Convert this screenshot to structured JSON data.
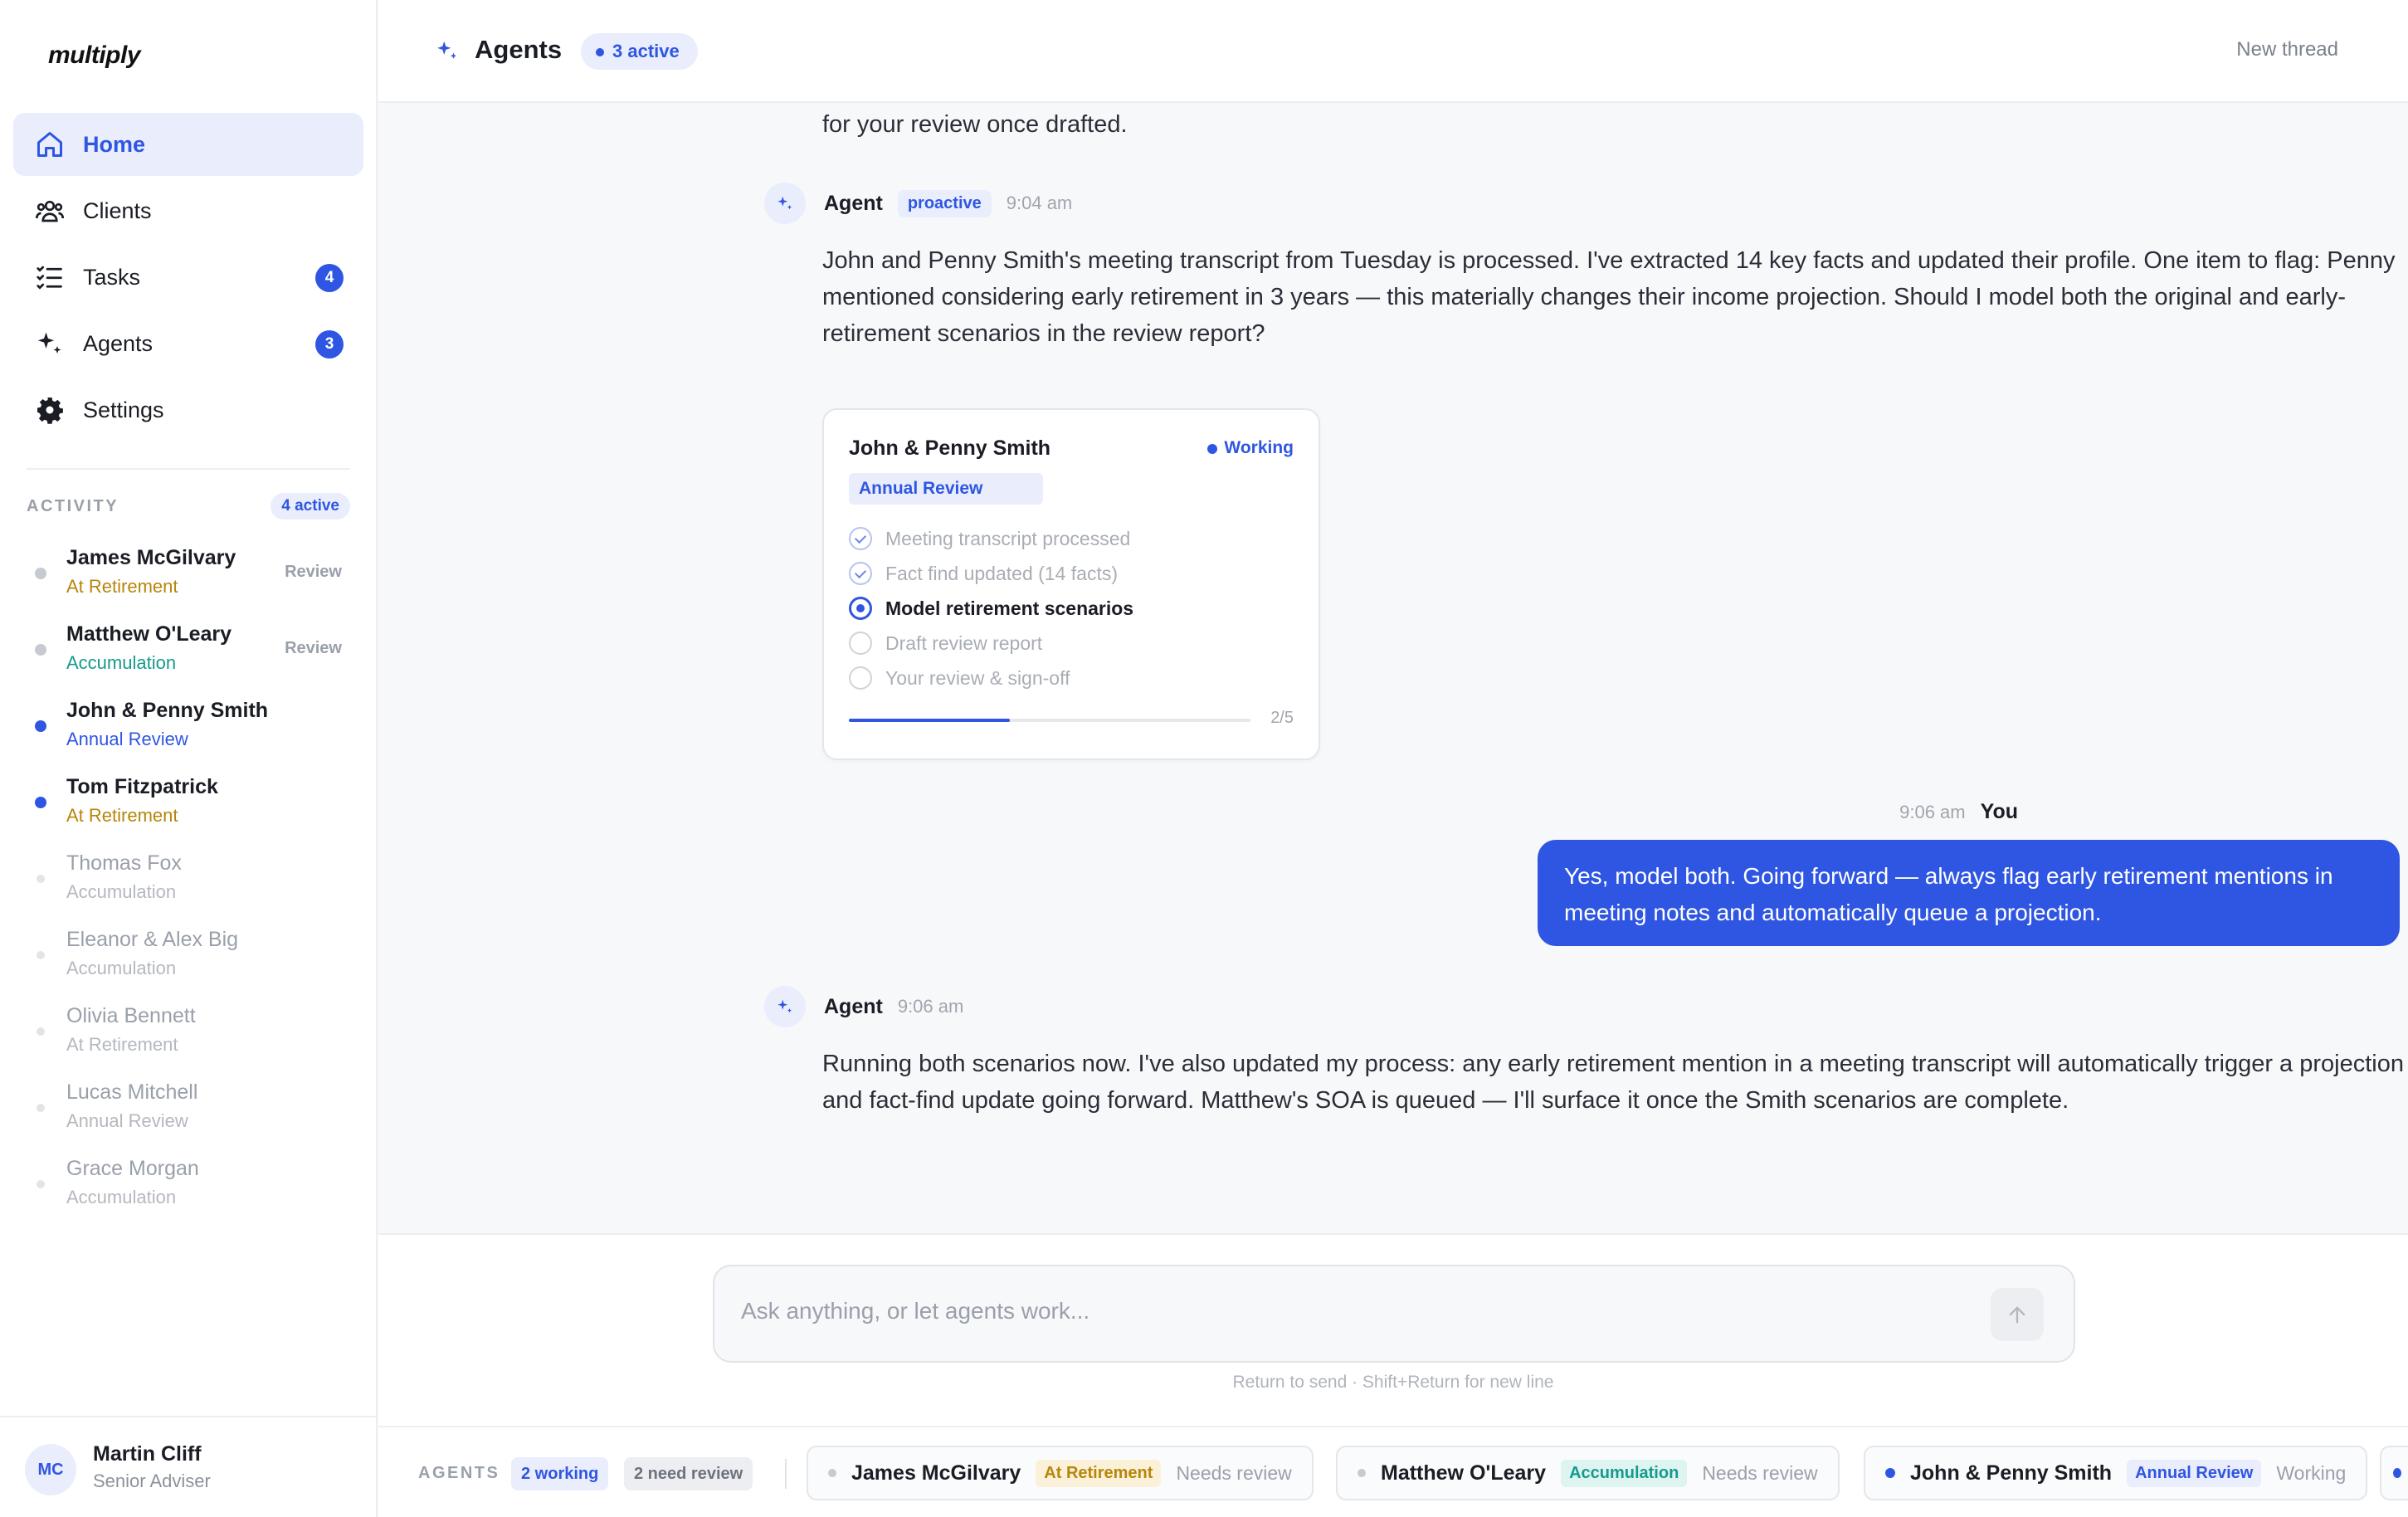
{
  "app": {
    "logo": "multiply"
  },
  "nav": [
    {
      "label": "Home",
      "icon": "home-icon",
      "active": true,
      "badge": ""
    },
    {
      "label": "Clients",
      "icon": "users-icon",
      "active": false,
      "badge": ""
    },
    {
      "label": "Tasks",
      "icon": "list-icon",
      "active": false,
      "badge": "4"
    },
    {
      "label": "Agents",
      "icon": "sparkle-icon",
      "active": false,
      "badge": "3"
    },
    {
      "label": "Settings",
      "icon": "gear-icon",
      "active": false,
      "badge": ""
    }
  ],
  "activity": {
    "label": "ACTIVITY",
    "count": "4 active",
    "items": [
      {
        "name": "James McGilvary",
        "stage": "At Retirement",
        "status": "Review"
      },
      {
        "name": "Matthew O'Leary",
        "stage": "Accumulation",
        "status": "Review"
      },
      {
        "name": "John & Penny Smith",
        "stage": "Annual Review",
        "status": ""
      },
      {
        "name": "Tom Fitzpatrick",
        "stage": "At Retirement",
        "status": ""
      },
      {
        "name": "Thomas Fox",
        "stage": "Accumulation",
        "status": ""
      },
      {
        "name": "Eleanor & Alex Big",
        "stage": "Accumulation",
        "status": ""
      },
      {
        "name": "Olivia Bennett",
        "stage": "At Retirement",
        "status": ""
      },
      {
        "name": "Lucas Mitchell",
        "stage": "Annual Review",
        "status": ""
      },
      {
        "name": "Grace Morgan",
        "stage": "Accumulation",
        "status": ""
      }
    ]
  },
  "user": {
    "initials": "MC",
    "name": "Martin Cliff",
    "role": "Senior Adviser"
  },
  "header": {
    "title": "Agents",
    "badge": "3 active",
    "new_thread": "New thread"
  },
  "chat": {
    "cut_text": "for your review once drafted.",
    "msg1": {
      "sender": "Agent",
      "tag": "proactive",
      "time": "9:04 am",
      "text": "John and Penny Smith's meeting transcript from Tuesday is processed. I've extracted 14 key facts and updated their profile. One item to flag: Penny mentioned considering early retirement in 3 years — this materially changes their income projection. Should I model both the original and early-retirement scenarios in the review report?"
    },
    "card": {
      "client": "John & Penny Smith",
      "status": "Working",
      "tag": "Annual Review",
      "steps": [
        {
          "label": "Meeting transcript processed",
          "state": "done"
        },
        {
          "label": "Fact find updated (14 facts)",
          "state": "done"
        },
        {
          "label": "Model retirement scenarios",
          "state": "current"
        },
        {
          "label": "Draft review report",
          "state": "todo"
        },
        {
          "label": "Your review & sign-off",
          "state": "todo"
        }
      ],
      "progress_text": "2/5",
      "progress_fraction": 0.4
    },
    "msg2": {
      "sender": "You",
      "time": "9:06 am",
      "text": "Yes, model both. Going forward — always flag early retirement mentions in meeting notes and automatically queue a projection."
    },
    "msg3": {
      "sender": "Agent",
      "time": "9:06 am",
      "text": "Running both scenarios now. I've also updated my process: any early retirement mention in a meeting transcript will automatically trigger a projection and fact-find update going forward. Matthew's SOA is queued — I'll surface it once the Smith scenarios are complete."
    }
  },
  "composer": {
    "placeholder": "Ask anything, or let agents work...",
    "hint": "Return to send · Shift+Return for new line"
  },
  "agentbar": {
    "label": "AGENTS",
    "working": "2 working",
    "review": "2 need review",
    "cards": [
      {
        "name": "James McGilvary",
        "tag": "At Retirement",
        "status": "Needs review"
      },
      {
        "name": "Matthew O'Leary",
        "tag": "Accumulation",
        "status": "Needs review"
      },
      {
        "name": "John & Penny Smith",
        "tag": "Annual Review",
        "status": "Working"
      }
    ]
  },
  "colors": {
    "accent": "#2f56e2",
    "amber": "#b7860b",
    "teal": "#169a8e"
  }
}
